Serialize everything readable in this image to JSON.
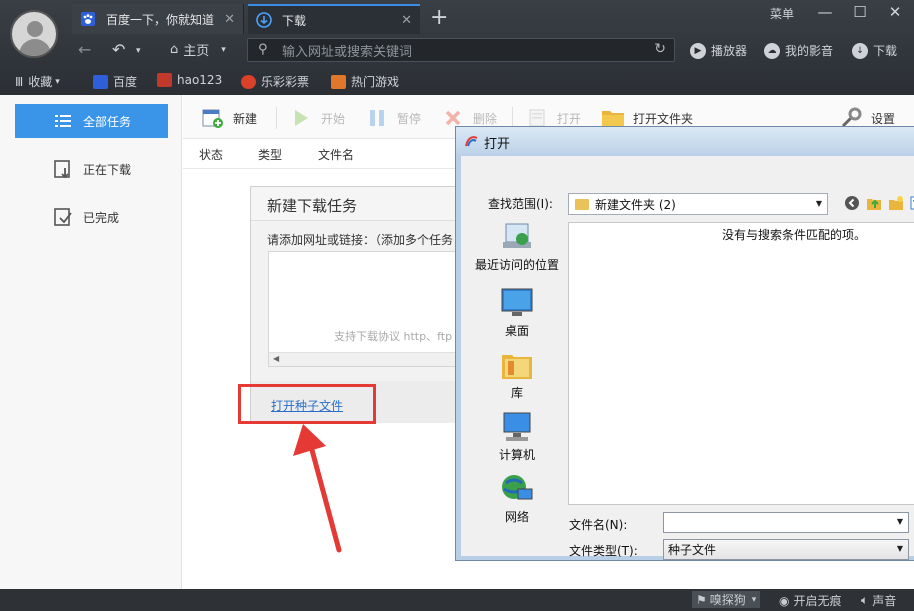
{
  "browser": {
    "tabs": [
      {
        "label": "百度一下，你就知道",
        "icon": "baidu-paw-icon"
      },
      {
        "label": "下载",
        "icon": "download-circle-icon"
      }
    ],
    "menu_label": "菜单",
    "home_label": "主页",
    "address_placeholder": "输入网址或搜索关键词",
    "right_tools": [
      "播放器",
      "我的影音",
      "下载"
    ],
    "bookmarks": [
      "收藏",
      "百度",
      "hao123",
      "乐彩彩票",
      "热门游戏"
    ]
  },
  "sidebar": {
    "items": [
      {
        "label": "全部任务",
        "active": true
      },
      {
        "label": "正在下载",
        "active": false
      },
      {
        "label": "已完成",
        "active": false
      }
    ]
  },
  "toolbar": {
    "new": "新建",
    "start": "开始",
    "pause": "暂停",
    "delete": "删除",
    "open": "打开",
    "open_folder": "打开文件夹",
    "settings": "设置"
  },
  "columns": [
    "状态",
    "类型",
    "文件名"
  ],
  "new_task": {
    "title": "新建下载任务",
    "hint": "请添加网址或链接：（添加多个任务",
    "placeholder": "支持下载协议 http、ftp",
    "seed_link": "打开种子文件"
  },
  "dialog": {
    "title": "打开",
    "look_in_label": "查找范围(I):",
    "look_in_value": "新建文件夹 (2)",
    "empty_message": "没有与搜索条件匹配的项。",
    "places": [
      "最近访问的位置",
      "桌面",
      "库",
      "计算机",
      "网络"
    ],
    "filename_label": "文件名(N):",
    "filename_value": "",
    "filetype_label": "文件类型(T):",
    "filetype_value": "种子文件"
  },
  "statusbar": {
    "items": [
      "嗅探狗",
      "开启无痕",
      "声音"
    ]
  },
  "colors": {
    "accent": "#3a95e8",
    "highlight": "#e53935",
    "chrome_bg": "#2b2f34"
  }
}
